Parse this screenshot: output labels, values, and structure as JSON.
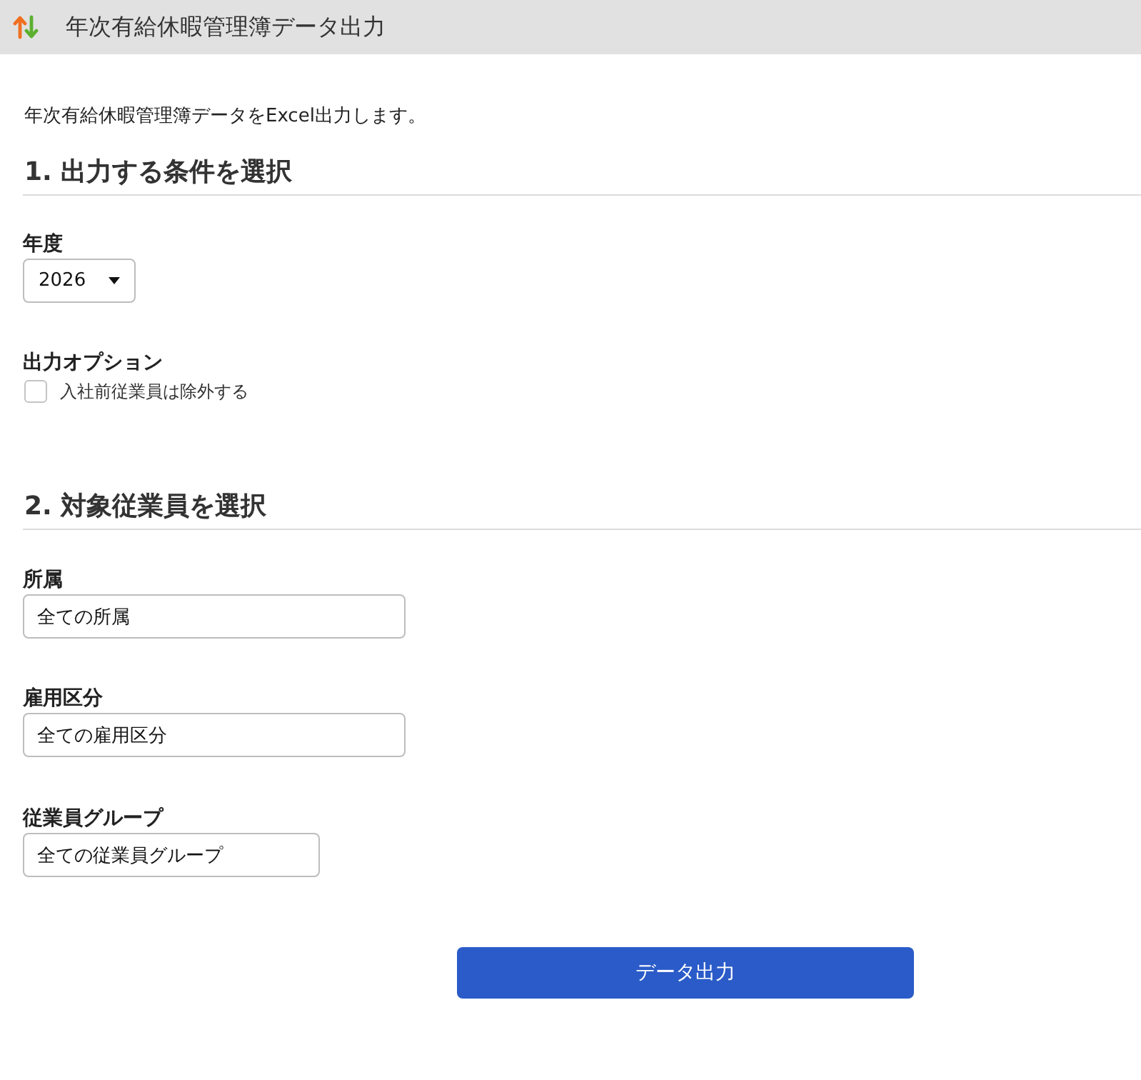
{
  "title_bar": {
    "title": "年次有給休暇管理簿データ出力"
  },
  "description": "年次有給休暇管理簿データをExcel出力します。",
  "sections": [
    {
      "heading": "1. 出力する条件を選択",
      "fields": [
        {
          "kind": "select",
          "label": "年度",
          "value": "2026"
        },
        {
          "kind": "checkbox",
          "label": "出力オプション",
          "option": "入社前従業員は除外する",
          "checked": false
        }
      ]
    },
    {
      "heading": "2. 対象従業員を選択",
      "fields": [
        {
          "kind": "input",
          "label": "所属",
          "value": "全ての所属"
        },
        {
          "kind": "input",
          "label": "雇用区分",
          "value": "全ての雇用区分"
        },
        {
          "kind": "input",
          "label": "従業員グループ",
          "value": "全ての従業員グループ"
        }
      ]
    }
  ],
  "submit_button": "データ出力"
}
